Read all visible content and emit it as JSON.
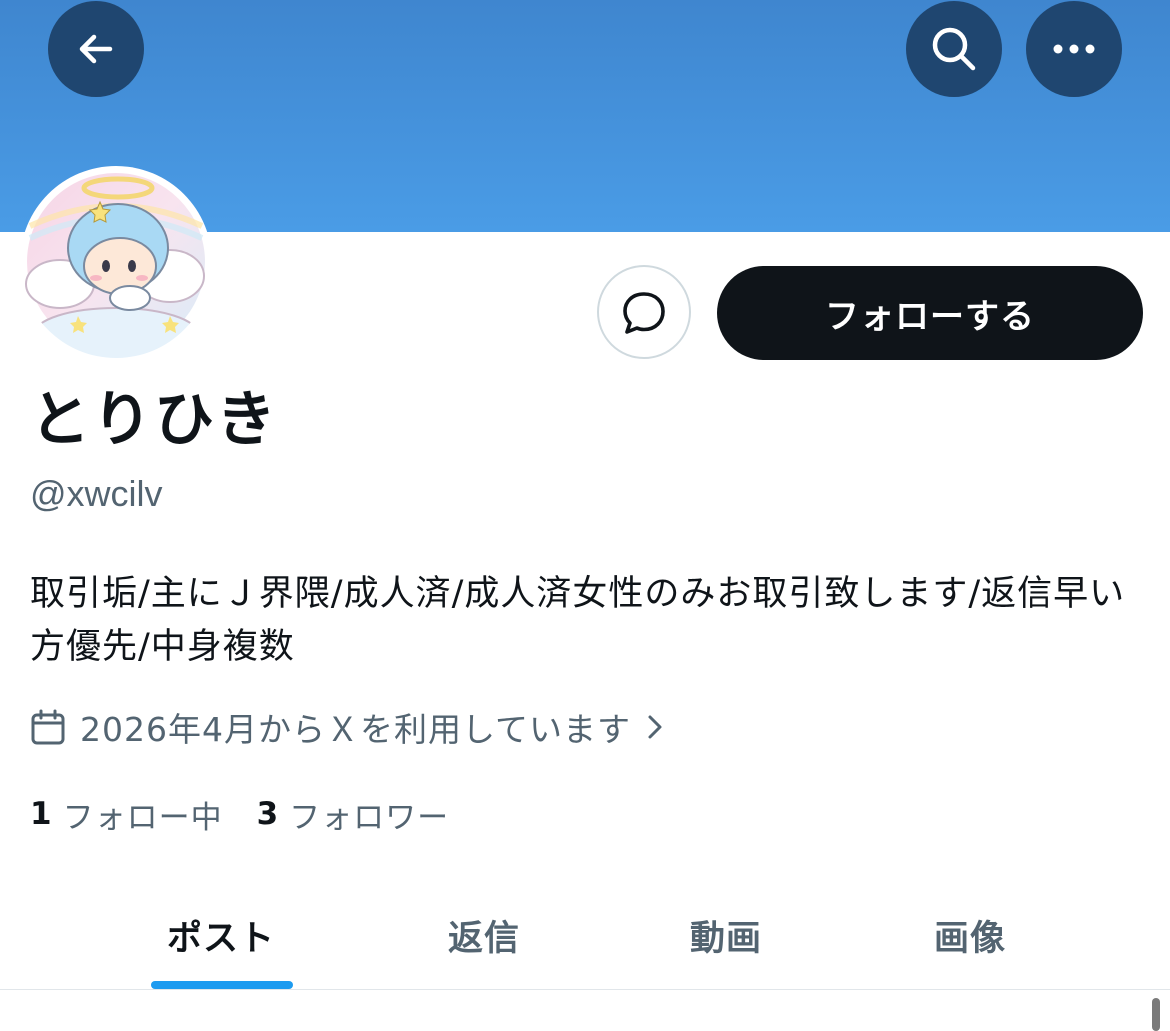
{
  "header": {
    "back_icon": "arrow-left-icon",
    "search_icon": "search-icon",
    "more_icon": "more-horizontal-icon",
    "banner_color": "#4a9ce6"
  },
  "profile": {
    "avatar_icon": "angel-character-avatar",
    "display_name": "とりひき",
    "handle": "@xwcilv",
    "bio": "取引垢/主にＪ界隈/成人済/成人済女性のみお取引致します/返信早い方優先/中身複数",
    "joined": "2026年4月からＸを利用しています",
    "following_count": "1",
    "following_label": "フォロー中",
    "followers_count": "3",
    "followers_label": "フォロワー"
  },
  "actions": {
    "message_icon": "message-bubble-icon",
    "follow_label": "フォローする"
  },
  "tabs": [
    {
      "label": "ポスト",
      "active": true
    },
    {
      "label": "返信",
      "active": false
    },
    {
      "label": "動画",
      "active": false
    },
    {
      "label": "画像",
      "active": false
    }
  ],
  "colors": {
    "accent": "#1d9bf0",
    "text": "#0f1419",
    "secondary_text": "#536471",
    "follow_button": "#0f1419"
  }
}
